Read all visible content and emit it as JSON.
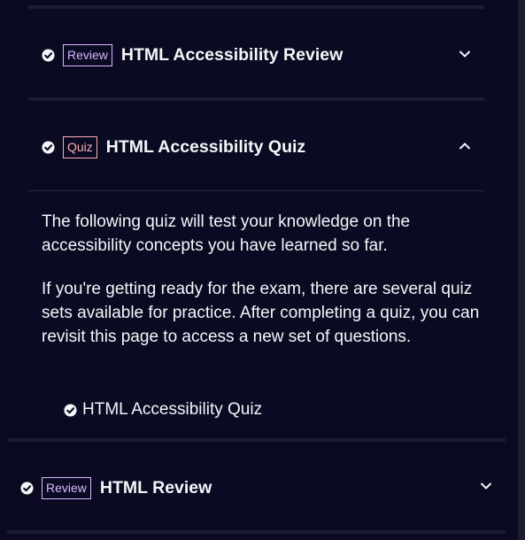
{
  "sections": [
    {
      "badge": "Review",
      "title": "HTML Accessibility Review",
      "expanded": false
    },
    {
      "badge": "Quiz",
      "title": "HTML Accessibility Quiz",
      "expanded": true,
      "paragraphs": [
        "The following quiz will test your knowledge on the accessibility concepts you have learned so far.",
        "If you're getting ready for the exam, there are several quiz sets available for practice. After completing a quiz, you can revisit this page to access a new set of questions."
      ],
      "link": "HTML Accessibility Quiz"
    },
    {
      "badge": "Review",
      "title": "HTML Review",
      "expanded": false
    }
  ],
  "icons": {
    "completed": "check-circle-icon",
    "collapsed": "chevron-down-icon",
    "expanded": "chevron-up-icon"
  },
  "colors": {
    "background": "#0a0a23",
    "divider": "#1b1b32",
    "text": "#f5f6f7",
    "review_badge": "#dbb8ff",
    "quiz_badge": "#ffadad"
  }
}
